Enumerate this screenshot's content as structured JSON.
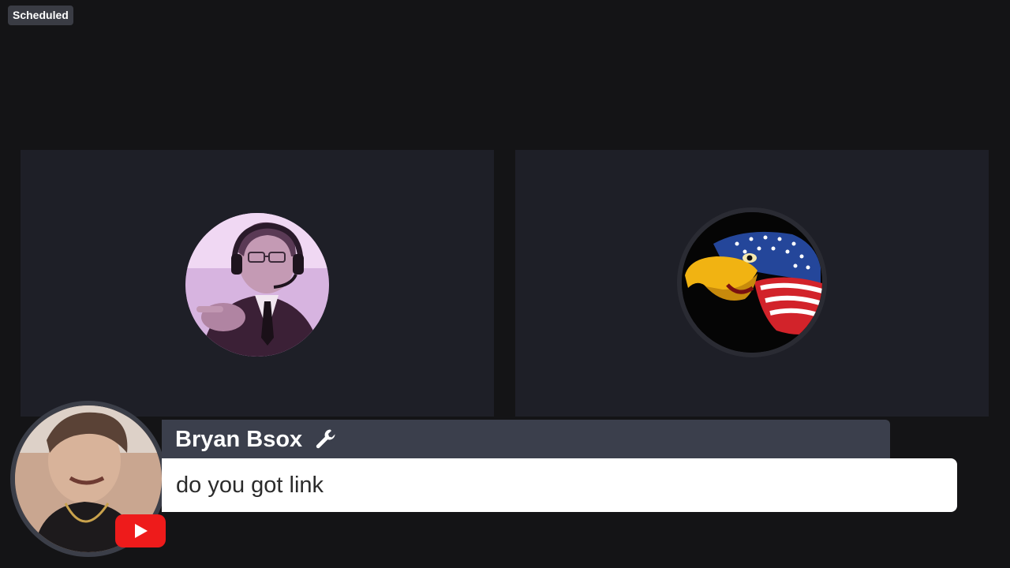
{
  "status_badge": "Scheduled",
  "participants": [
    {
      "avatar": "person-with-headset-avatar"
    },
    {
      "avatar": "american-flag-eagle-avatar"
    }
  ],
  "chat": {
    "author": "Bryan Bsox",
    "author_icon": "wrench-icon",
    "message": "do you got link",
    "platform_icon": "youtube-icon"
  },
  "colors": {
    "background": "#141416",
    "tile": "#1e1f27",
    "name_bar": "#3b3f4c",
    "message_bar": "#ffffff",
    "youtube_red": "#ee1b1b"
  }
}
